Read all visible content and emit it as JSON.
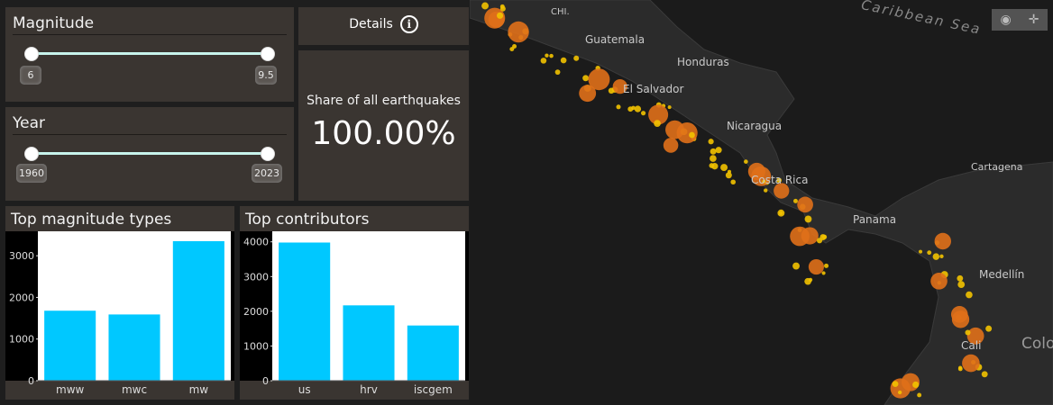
{
  "magnitude": {
    "title": "Magnitude",
    "min_label": "6",
    "max_label": "9.5"
  },
  "year": {
    "title": "Year",
    "min_label": "1960",
    "max_label": "2023"
  },
  "details": {
    "label": "Details",
    "info_icon": "info-icon"
  },
  "share": {
    "label": "Share of all earthquakes",
    "value": "100.00%"
  },
  "chart_data": [
    {
      "type": "bar",
      "title": "Top magnitude types",
      "categories": [
        "mww",
        "mwc",
        "mw"
      ],
      "values": [
        1680,
        1590,
        3350
      ],
      "yticks": [
        "0",
        "1000",
        "2000",
        "3000"
      ],
      "ylim": [
        0,
        3500
      ],
      "color": "#00c8ff"
    },
    {
      "type": "bar",
      "title": "Top contributors",
      "categories": [
        "us",
        "hrv",
        "iscgem"
      ],
      "values": [
        3980,
        2170,
        1590
      ],
      "yticks": [
        "0",
        "1000",
        "2000",
        "3000",
        "4000"
      ],
      "ylim": [
        0,
        4200
      ],
      "color": "#00c8ff"
    }
  ],
  "map": {
    "labels": [
      "CHI.",
      "Guatemala",
      "Honduras",
      "El Salvador",
      "Nicaragua",
      "Costa Rica",
      "Panama",
      "Cartagena",
      "Medellín",
      "Cali",
      "Colo",
      "Caribbean Sea"
    ],
    "modebar": {
      "camera_icon": "camera-icon",
      "pan_icon": "pan-icon"
    }
  }
}
